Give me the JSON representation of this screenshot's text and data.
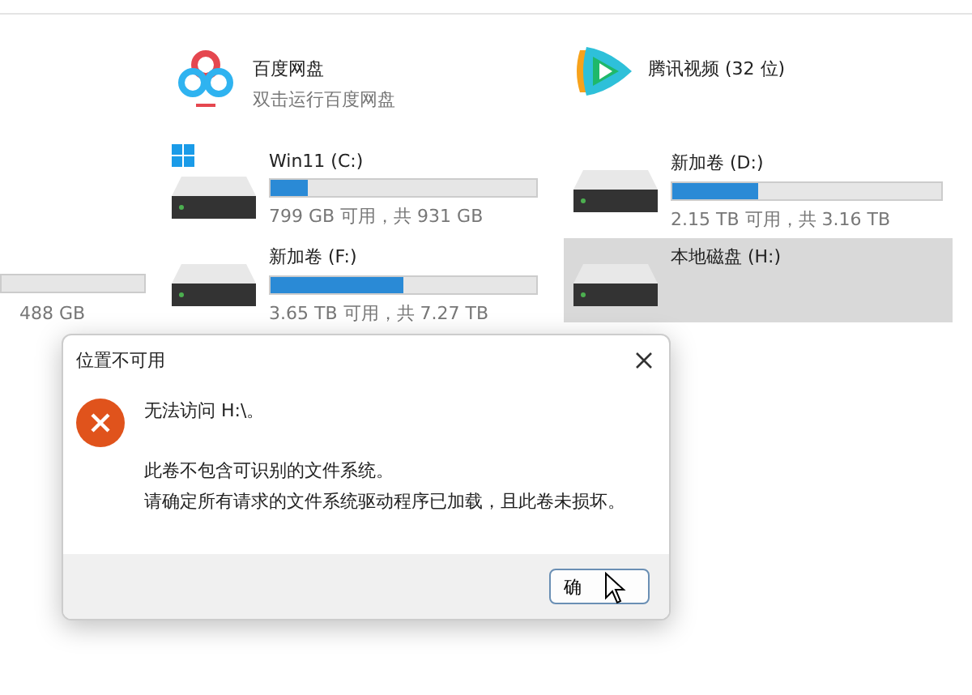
{
  "apps": [
    {
      "kind": "baidu",
      "name": "百度网盘",
      "subtitle": "双击运行百度网盘"
    },
    {
      "kind": "tencent",
      "name": "腾讯视频 (32 位)"
    }
  ],
  "partial_drive": {
    "caption": "488 GB"
  },
  "drives": [
    {
      "name": "Win11 (C:)",
      "system": true,
      "level": 0.14,
      "caption": "799 GB 可用，共 931 GB",
      "selected": false
    },
    {
      "name": "新加卷 (D:)",
      "system": false,
      "level": 0.32,
      "caption": "2.15 TB 可用，共 3.16 TB",
      "selected": false
    },
    {
      "name": "新加卷 (F:)",
      "system": false,
      "level": 0.5,
      "caption": "3.65 TB 可用，共 7.27 TB",
      "selected": false
    },
    {
      "name": "本地磁盘 (H:)",
      "system": false,
      "selected": true
    }
  ],
  "dialog": {
    "title": "位置不可用",
    "heading": "无法访问 H:\\。",
    "lines": [
      "此卷不包含可识别的文件系统。",
      "请确定所有请求的文件系统驱动程序已加载，且此卷未损坏。"
    ],
    "button": "确"
  }
}
